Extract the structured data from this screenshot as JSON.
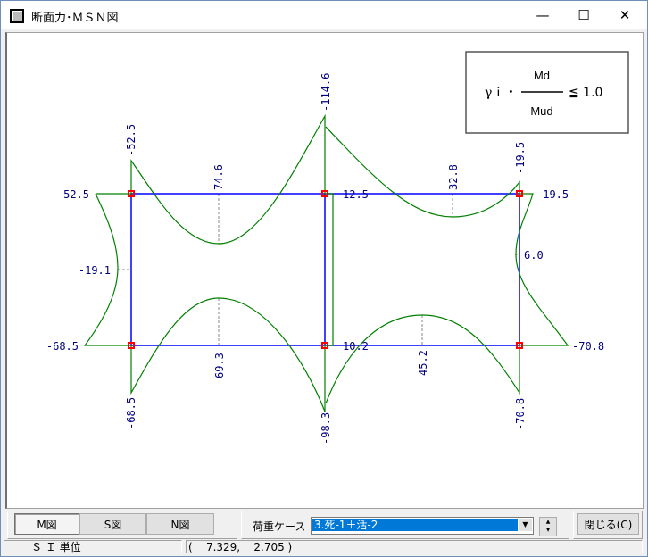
{
  "window": {
    "title": "断面力･ＭＳＮ図",
    "minimize": "—",
    "maximize": "☐",
    "close": "✕"
  },
  "formula": {
    "lhs": "γｉ・",
    "numerator": "Md",
    "denominator": "Mud",
    "rhs": "≦ 1.0"
  },
  "diagram": {
    "labels": {
      "top_left_end": "-52.5",
      "top_left_vertical": "-52.5",
      "top_left_span": "74.6",
      "top_mid_vertical": "-114.6",
      "top_mid_right": "12.5",
      "top_right_span": "32.8",
      "top_right_vertical": "-19.5",
      "top_right_end": "-19.5",
      "left_column_mid": "-19.1",
      "right_column_mid": "6.0",
      "bottom_left_end": "-68.5",
      "bottom_left_vertical": "-68.5",
      "bottom_left_span": "69.3",
      "bottom_mid_vertical": "-98.3",
      "bottom_mid_right": "10.2",
      "bottom_right_span": "45.2",
      "bottom_right_vertical": "-70.8",
      "bottom_right_end": "-70.8"
    },
    "colors": {
      "frame": "#0000ff",
      "moment": "#008000",
      "node": "#ff0000",
      "label": "#000080"
    }
  },
  "toolbar": {
    "m_button": "M図",
    "s_button": "S図",
    "n_button": "N図",
    "load_case_label": "荷重ケース",
    "load_case_value": "3.死-1＋活-2",
    "close_button": "閉じる(C)"
  },
  "status": {
    "units": "Ｓ Ｉ 単位",
    "coords": "(    7.329,    2.705 )"
  }
}
